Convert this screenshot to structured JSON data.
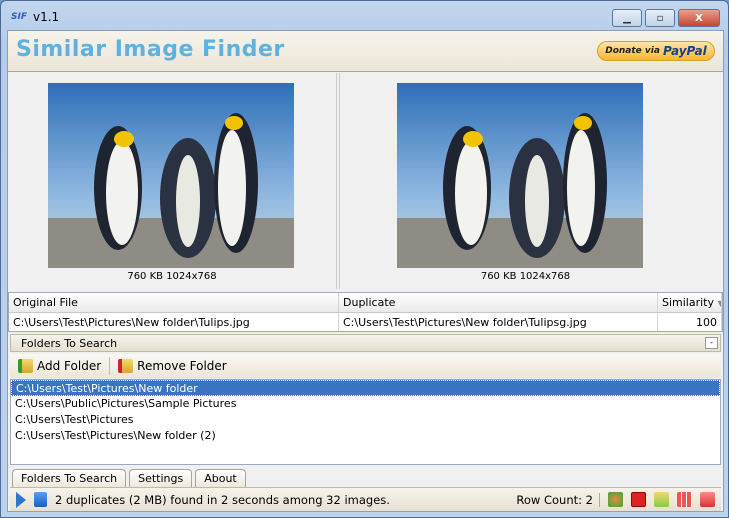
{
  "window": {
    "title": "v1.1",
    "app_icon_text": "SIF"
  },
  "banner": {
    "logo": "Similar Image Finder",
    "donate_prefix": "Donate via",
    "donate_brand": "PayPal"
  },
  "preview": {
    "left_caption": "760 KB 1024x768",
    "right_caption": "760 KB 1024x768"
  },
  "results": {
    "columns": [
      "Original File",
      "Duplicate",
      "Similarity"
    ],
    "rows": [
      {
        "original": "C:\\Users\\Test\\Pictures\\New folder\\Tulips.jpg",
        "duplicate": "C:\\Users\\Test\\Pictures\\New folder\\Tulipsg.jpg",
        "similarity": "100"
      }
    ]
  },
  "folders": {
    "title": "Folders To Search",
    "add_label": "Add Folder",
    "remove_label": "Remove Folder",
    "items": [
      "C:\\Users\\Test\\Pictures\\New folder",
      "C:\\Users\\Public\\Pictures\\Sample Pictures",
      "C:\\Users\\Test\\Pictures",
      "C:\\Users\\Test\\Pictures\\New folder (2)"
    ]
  },
  "tabs": [
    "Folders To Search",
    "Settings",
    "About"
  ],
  "status": {
    "message": "2 duplicates (2 MB) found in 2 seconds among 32 images.",
    "row_count": "Row Count: 2"
  }
}
